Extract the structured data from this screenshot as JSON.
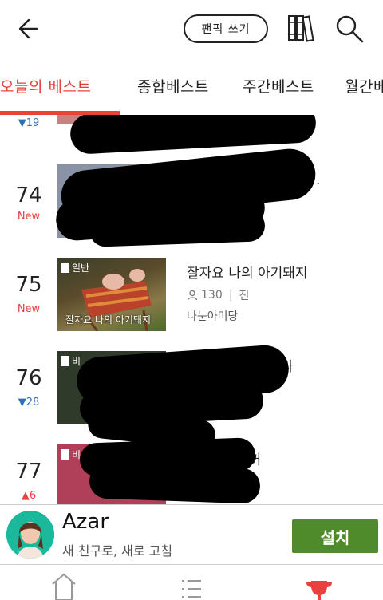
{
  "header": {
    "back_icon": "arrow-left-icon",
    "write_label": "팬픽 쓰기",
    "library_icon": "bookshelf-icon",
    "search_icon": "search-icon"
  },
  "tabs": [
    {
      "label": "오늘의 베스트",
      "active": true
    },
    {
      "label": "종합베스트",
      "active": false
    },
    {
      "label": "주간베스트",
      "active": false
    },
    {
      "label": "월간베",
      "active": false
    }
  ],
  "rows": [
    {
      "rank": "",
      "change": "▼19",
      "change_type": "down",
      "title": "",
      "views": "",
      "author": ""
    },
    {
      "rank": "74",
      "change": "New",
      "change_type": "new",
      "title": ".",
      "views": "",
      "author": ""
    },
    {
      "rank": "75",
      "change": "New",
      "change_type": "new",
      "badge": "일반",
      "thumb_caption": "잘자요 나의 아기돼지",
      "title": "잘자요 나의 아기돼지",
      "views": "130",
      "status": "진",
      "author": "나눈아미당"
    },
    {
      "rank": "76",
      "change": "▼28",
      "change_type": "down",
      "badge": "비",
      "title": "다",
      "views": "",
      "author": ""
    },
    {
      "rank": "77",
      "change": "▲6",
      "change_type": "up",
      "badge": "비",
      "title": "내꺼",
      "views": "",
      "author": ""
    }
  ],
  "ad": {
    "name": "Azar",
    "description": "새 친구로, 새로 고침",
    "install_label": "설치"
  },
  "bottom_nav": [
    {
      "icon": "home-icon"
    },
    {
      "icon": "list-icon"
    },
    {
      "icon": "trophy-icon",
      "active": true
    }
  ],
  "colors": {
    "accent": "#e8413e",
    "down": "#2f6fb3",
    "install": "#4f8a2b"
  }
}
